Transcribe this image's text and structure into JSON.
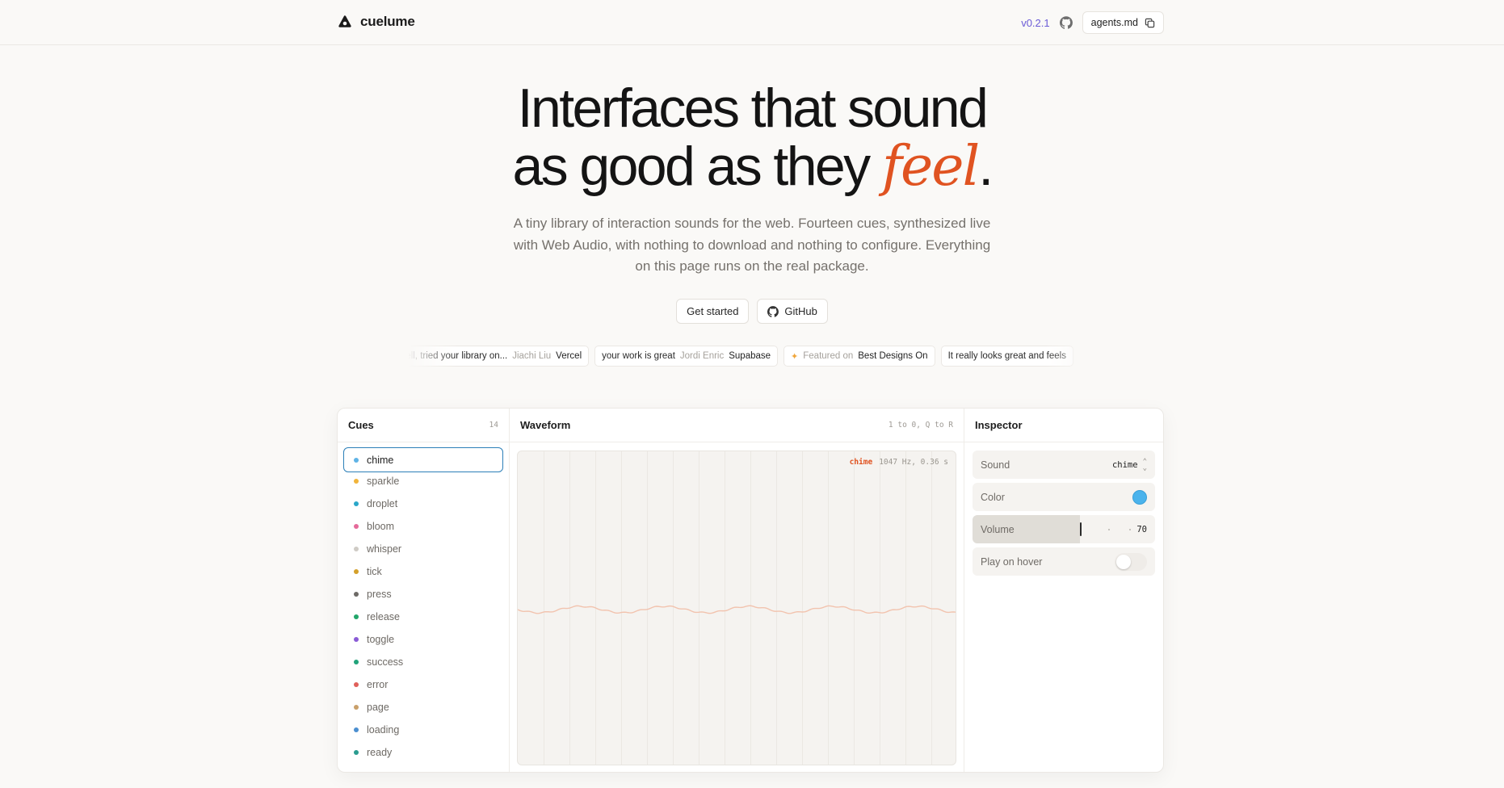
{
  "header": {
    "brand": "cuelume",
    "version": "v0.2.1",
    "agents_label": "agents.md"
  },
  "hero": {
    "title_line1": "Interfaces that sound",
    "title_line2_prefix": "as good as they ",
    "title_line2_accent": "feel",
    "title_line2_suffix": ".",
    "subtitle": "A tiny library of interaction sounds for the web. Fourteen cues, synthesized live with Web Audio, with nothing to download and nothing to configure. Everything on this page runs on the real package.",
    "cta_primary": "Get started",
    "cta_secondary": "GitHub"
  },
  "testimonials": [
    {
      "quote": "well, tried your library on...",
      "who": "Jiachi Liu",
      "org": "Vercel"
    },
    {
      "quote": "your work is great",
      "who": "Jordi Enric",
      "org": "Supabase"
    },
    {
      "quote": "Featured on",
      "who": "",
      "org": "Best Designs On",
      "featured": true
    },
    {
      "quote": "It really looks great and feels",
      "who": "",
      "org": ""
    }
  ],
  "cues": {
    "title": "Cues",
    "count": "14",
    "items": [
      {
        "name": "chime",
        "color": "#5fb3e6",
        "active": true
      },
      {
        "name": "sparkle",
        "color": "#f1b43a"
      },
      {
        "name": "droplet",
        "color": "#2aa7c9"
      },
      {
        "name": "bloom",
        "color": "#e56a9a"
      },
      {
        "name": "whisper",
        "color": "#cfcbc5"
      },
      {
        "name": "tick",
        "color": "#d4a02a"
      },
      {
        "name": "press",
        "color": "#6d6a66"
      },
      {
        "name": "release",
        "color": "#22a66a"
      },
      {
        "name": "toggle",
        "color": "#8a5bd6"
      },
      {
        "name": "success",
        "color": "#21a37a"
      },
      {
        "name": "error",
        "color": "#e0605a"
      },
      {
        "name": "page",
        "color": "#c9a06a"
      },
      {
        "name": "loading",
        "color": "#4b8fd0"
      },
      {
        "name": "ready",
        "color": "#2a9c8f"
      }
    ]
  },
  "waveform": {
    "title": "Waveform",
    "shortcut_hint": "1 to 0, Q to R",
    "label_name": "chime",
    "label_info": "1047 Hz, 0.36 s",
    "wave_color": "#f2c3ae"
  },
  "inspector": {
    "title": "Inspector",
    "sound_label": "Sound",
    "sound_value": "chime",
    "color_label": "Color",
    "color_value": "#4bb3ec",
    "volume_label": "Volume",
    "volume_value": "70",
    "volume_fraction": 0.7,
    "hover_label": "Play on hover",
    "hover_on": false
  }
}
